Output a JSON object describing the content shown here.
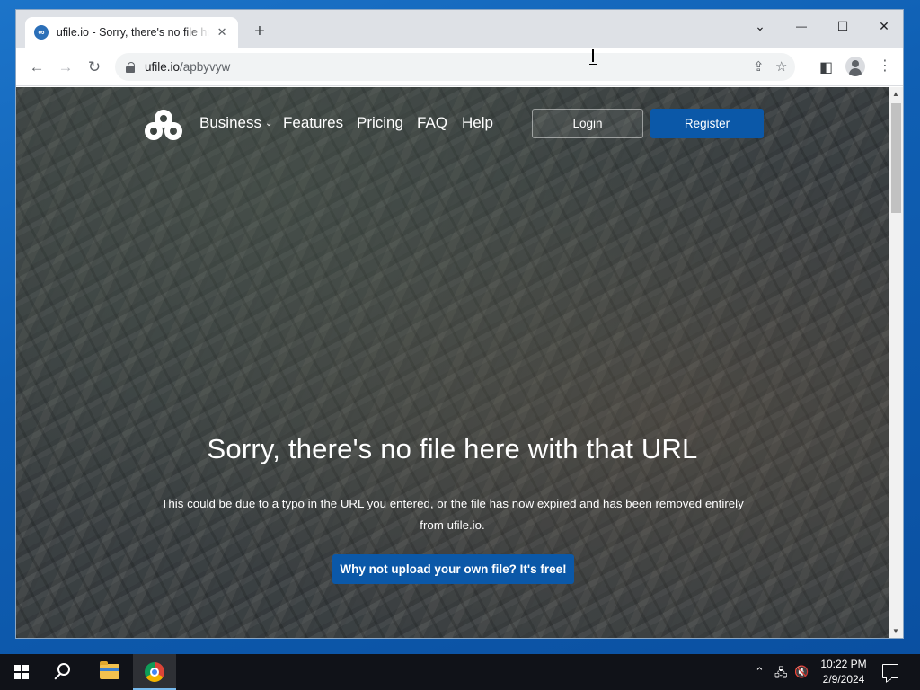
{
  "browser": {
    "tab_title": "ufile.io - Sorry, there's no file here",
    "tab_close": "✕",
    "new_tab": "+",
    "url_host": "ufile.io",
    "url_path": "/apbyvyw",
    "window_controls": {
      "tab_search": "⌄",
      "minimize": "—",
      "maximize": "☐",
      "close": "✕"
    },
    "nav": {
      "back": "←",
      "forward": "→",
      "reload": "↻"
    },
    "toolbar_icons": {
      "share": "⇪",
      "bookmark": "☆",
      "side_panel": "◧",
      "menu": "⋮"
    }
  },
  "site": {
    "nav": {
      "business": "Business",
      "business_caret": "⌄",
      "features": "Features",
      "pricing": "Pricing",
      "faq": "FAQ",
      "help": "Help",
      "login": "Login",
      "register": "Register"
    },
    "hero": {
      "title": "Sorry, there's no file here with that URL",
      "text": "This could be due to a typo in the URL you entered, or the file has now expired and has been removed entirely from ufile.io.",
      "upload_button": "Why not upload your own file? It's free!"
    },
    "colors": {
      "primary_button": "#0b58a8"
    }
  },
  "scrollbar": {
    "up": "▲",
    "down": "▼"
  },
  "taskbar": {
    "time": "10:22 PM",
    "date": "2/9/2024",
    "tray": {
      "chevron": "⌃",
      "network": "🖧",
      "volume": "🔇"
    }
  }
}
